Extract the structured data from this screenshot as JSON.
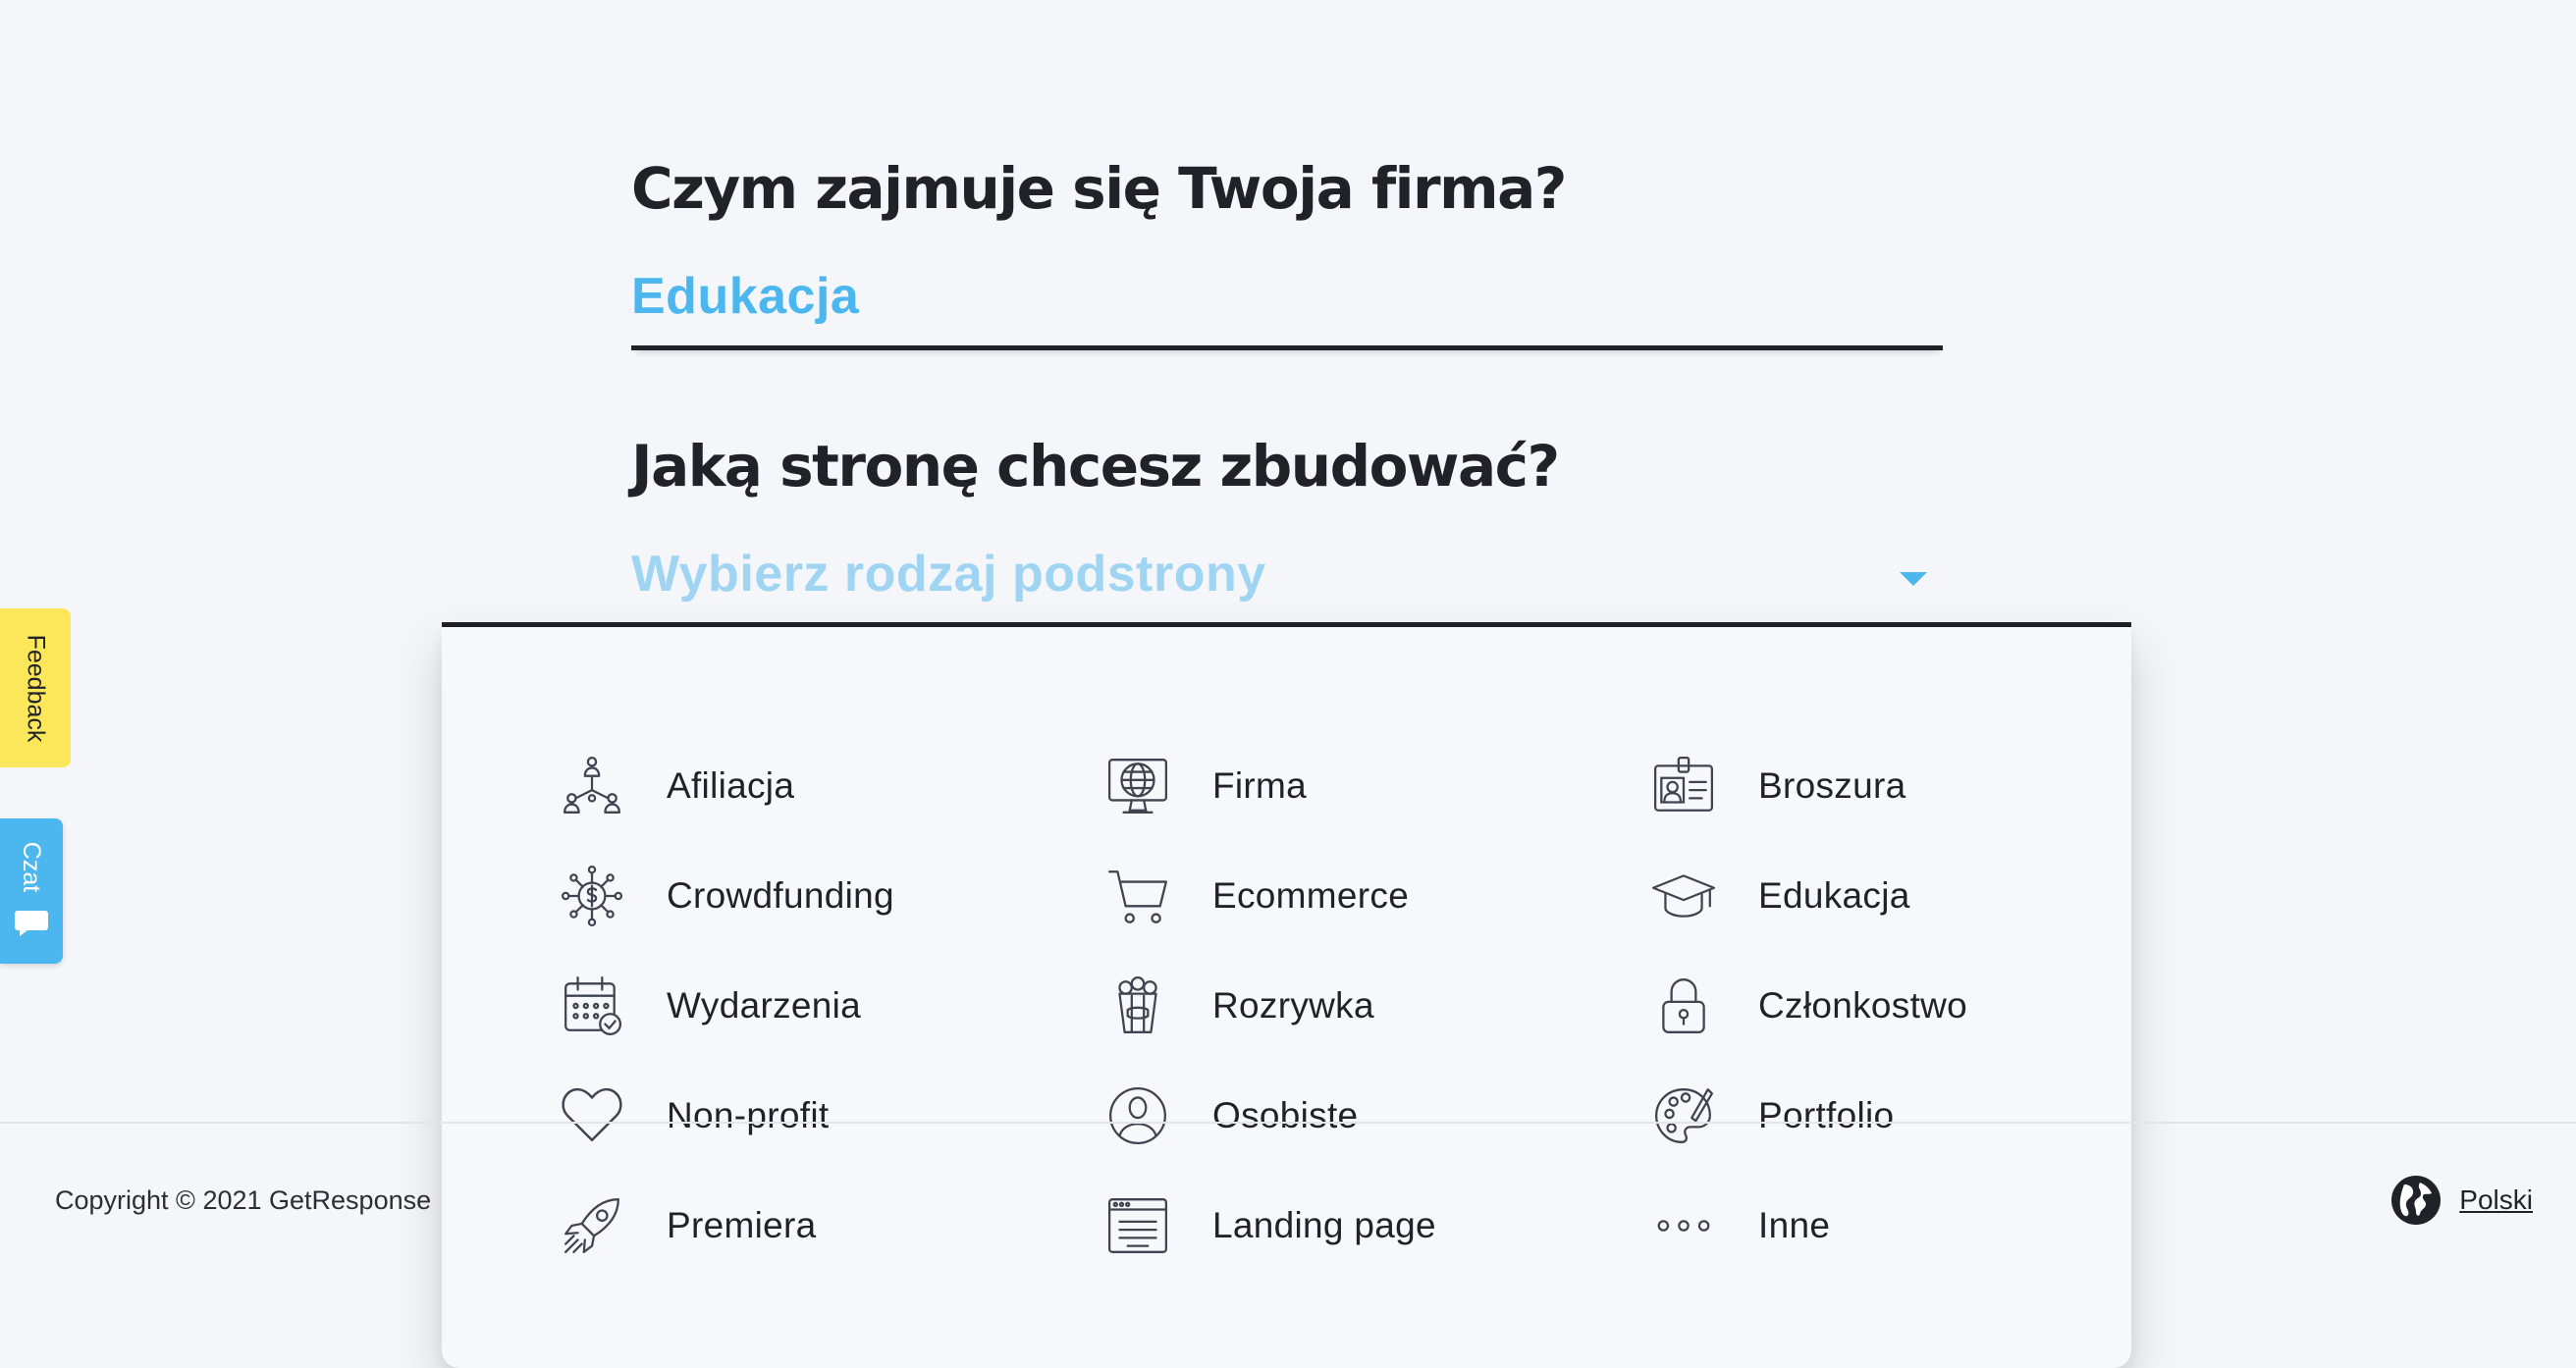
{
  "form": {
    "question1": "Czym zajmuje się Twoja firma?",
    "answer1": "Edukacja",
    "question2": "Jaką stronę chcesz zbudować?",
    "select_placeholder": "Wybierz rodzaj podstrony"
  },
  "dropdown": {
    "items": [
      {
        "label": "Afiliacja",
        "icon": "affiliate-network-icon"
      },
      {
        "label": "Firma",
        "icon": "globe-monitor-icon"
      },
      {
        "label": "Broszura",
        "icon": "id-card-icon"
      },
      {
        "label": "Crowdfunding",
        "icon": "dollar-network-icon"
      },
      {
        "label": "Ecommerce",
        "icon": "shopping-cart-icon"
      },
      {
        "label": "Edukacja",
        "icon": "graduation-cap-icon"
      },
      {
        "label": "Wydarzenia",
        "icon": "calendar-icon"
      },
      {
        "label": "Rozrywka",
        "icon": "popcorn-icon"
      },
      {
        "label": "Członkostwo",
        "icon": "padlock-icon"
      },
      {
        "label": "Non-profit",
        "icon": "heart-icon"
      },
      {
        "label": "Osobiste",
        "icon": "user-circle-icon"
      },
      {
        "label": "Portfolio",
        "icon": "palette-icon"
      },
      {
        "label": "Premiera",
        "icon": "rocket-icon"
      },
      {
        "label": "Landing page",
        "icon": "browser-page-icon"
      },
      {
        "label": "Inne",
        "icon": "more-dots-icon"
      }
    ]
  },
  "footer": {
    "copyright": "Copyright © 2021 GetResponse",
    "language": "Polski"
  },
  "side_tabs": {
    "feedback": "Feedback",
    "chat": "Czat"
  },
  "colors": {
    "accent": "#4bb7ee",
    "placeholder": "#9fd4f3",
    "feedback_tab": "#fbe759",
    "background": "#f5f6fa"
  }
}
